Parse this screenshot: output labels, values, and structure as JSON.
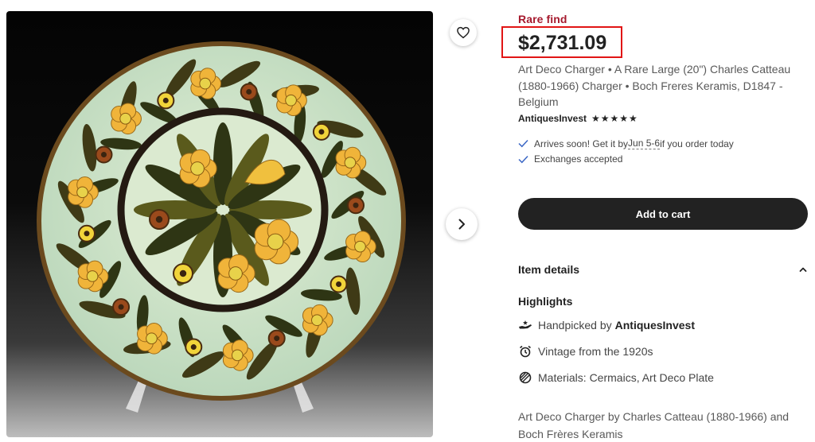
{
  "listing": {
    "image_alt_icon": "plate-image",
    "rare_label": "Rare find",
    "price": "$2,731.09",
    "title": "Art Deco Charger • A Rare Large (20\") Charles Catteau (1880-1966) Charger • Boch Freres Keramis, D1847 - Belgium",
    "shop_name": "AntiquesInvest",
    "rating_stars": "★★★★★",
    "rating_value": 5
  },
  "shipping": {
    "arrives_prefix": "Arrives soon! Get it by ",
    "arrives_date": "Jun 5-6",
    "arrives_suffix": " if you order today",
    "exchanges": "Exchanges accepted"
  },
  "actions": {
    "add_to_cart": "Add to cart"
  },
  "details": {
    "section_label": "Item details",
    "highlights_label": "Highlights",
    "handpicked_prefix": "Handpicked by",
    "handpicked_shop": "AntiquesInvest",
    "vintage": "Vintage from the 1920s",
    "materials": "Materials: Cermaics, Art Deco Plate",
    "description": "Art Deco Charger by Charles Catteau (1880-1966) and Boch Frères Keramis"
  },
  "colors": {
    "accent_rare": "#a61a2e",
    "cart_button": "#222222",
    "annotation_box": "#e11515",
    "check": "#3b67c5"
  }
}
